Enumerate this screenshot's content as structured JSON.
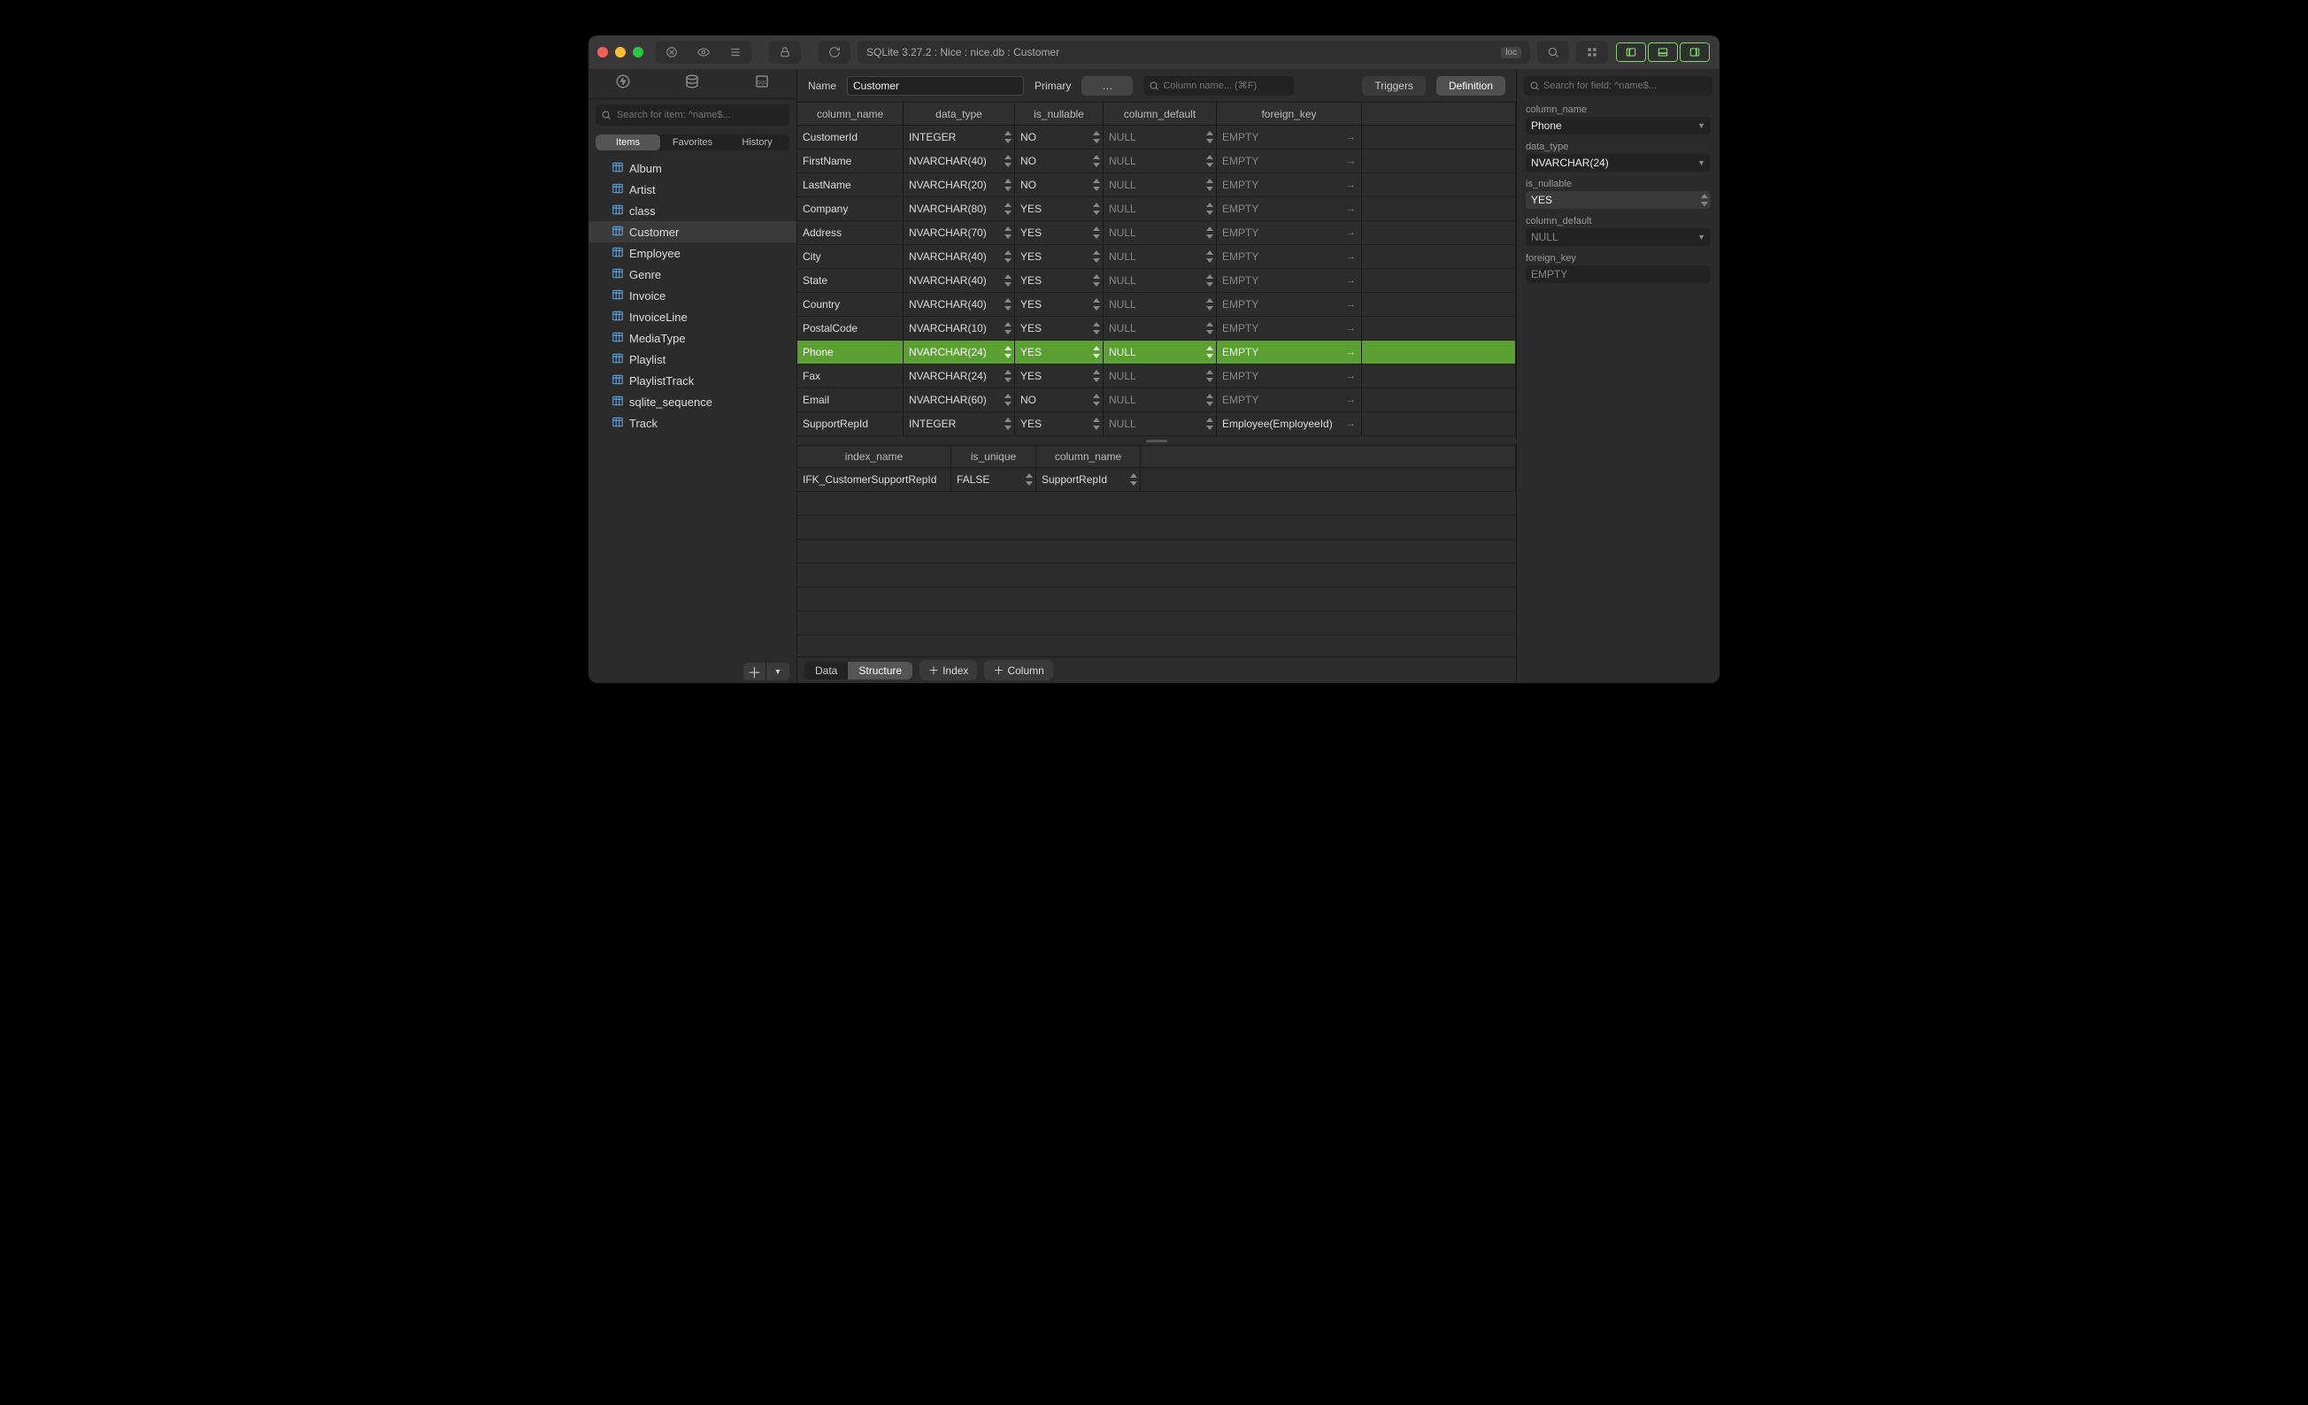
{
  "titlebar": {
    "path": "SQLite 3.27.2 : Nice : nice.db : Customer",
    "loc_badge": "loc"
  },
  "sidebar": {
    "search_placeholder": "Search for item: ^name$...",
    "tabs": {
      "items": "Items",
      "favorites": "Favorites",
      "history": "History"
    },
    "items": [
      {
        "label": "Album"
      },
      {
        "label": "Artist"
      },
      {
        "label": "class"
      },
      {
        "label": "Customer",
        "selected": true
      },
      {
        "label": "Employee"
      },
      {
        "label": "Genre"
      },
      {
        "label": "Invoice"
      },
      {
        "label": "InvoiceLine"
      },
      {
        "label": "MediaType"
      },
      {
        "label": "Playlist"
      },
      {
        "label": "PlaylistTrack"
      },
      {
        "label": "sqlite_sequence"
      },
      {
        "label": "Track"
      }
    ]
  },
  "header": {
    "name_label": "Name",
    "name_value": "Customer",
    "primary_label": "Primary",
    "primary_btn": "…",
    "col_search_placeholder": "Column name... (⌘F)",
    "triggers": "Triggers",
    "definition": "Definition"
  },
  "columns": {
    "headers": {
      "name": "column_name",
      "type": "data_type",
      "null": "is_nullable",
      "def": "column_default",
      "fk": "foreign_key"
    },
    "rows": [
      {
        "name": "CustomerId",
        "type": "INTEGER",
        "null": "NO",
        "def": "NULL",
        "fk": "EMPTY"
      },
      {
        "name": "FirstName",
        "type": "NVARCHAR(40)",
        "null": "NO",
        "def": "NULL",
        "fk": "EMPTY"
      },
      {
        "name": "LastName",
        "type": "NVARCHAR(20)",
        "null": "NO",
        "def": "NULL",
        "fk": "EMPTY"
      },
      {
        "name": "Company",
        "type": "NVARCHAR(80)",
        "null": "YES",
        "def": "NULL",
        "fk": "EMPTY"
      },
      {
        "name": "Address",
        "type": "NVARCHAR(70)",
        "null": "YES",
        "def": "NULL",
        "fk": "EMPTY"
      },
      {
        "name": "City",
        "type": "NVARCHAR(40)",
        "null": "YES",
        "def": "NULL",
        "fk": "EMPTY"
      },
      {
        "name": "State",
        "type": "NVARCHAR(40)",
        "null": "YES",
        "def": "NULL",
        "fk": "EMPTY"
      },
      {
        "name": "Country",
        "type": "NVARCHAR(40)",
        "null": "YES",
        "def": "NULL",
        "fk": "EMPTY"
      },
      {
        "name": "PostalCode",
        "type": "NVARCHAR(10)",
        "null": "YES",
        "def": "NULL",
        "fk": "EMPTY"
      },
      {
        "name": "Phone",
        "type": "NVARCHAR(24)",
        "null": "YES",
        "def": "NULL",
        "fk": "EMPTY",
        "selected": true
      },
      {
        "name": "Fax",
        "type": "NVARCHAR(24)",
        "null": "YES",
        "def": "NULL",
        "fk": "EMPTY"
      },
      {
        "name": "Email",
        "type": "NVARCHAR(60)",
        "null": "NO",
        "def": "NULL",
        "fk": "EMPTY"
      },
      {
        "name": "SupportRepId",
        "type": "INTEGER",
        "null": "YES",
        "def": "NULL",
        "fk": "Employee(EmployeeId)"
      }
    ]
  },
  "indexes": {
    "headers": {
      "name": "index_name",
      "uniq": "is_unique",
      "col": "column_name"
    },
    "rows": [
      {
        "name": "IFK_CustomerSupportRepId",
        "uniq": "FALSE",
        "col": "SupportRepId"
      }
    ]
  },
  "footer": {
    "data": "Data",
    "structure": "Structure",
    "add_index": "Index",
    "add_column": "Column"
  },
  "right": {
    "search_placeholder": "Search for field: ^name$...",
    "fields": {
      "column_name": {
        "label": "column_name",
        "value": "Phone"
      },
      "data_type": {
        "label": "data_type",
        "value": "NVARCHAR(24)"
      },
      "is_nullable": {
        "label": "is_nullable",
        "value": "YES"
      },
      "column_default": {
        "label": "column_default",
        "value": "NULL"
      },
      "foreign_key": {
        "label": "foreign_key",
        "value": "EMPTY"
      }
    }
  }
}
